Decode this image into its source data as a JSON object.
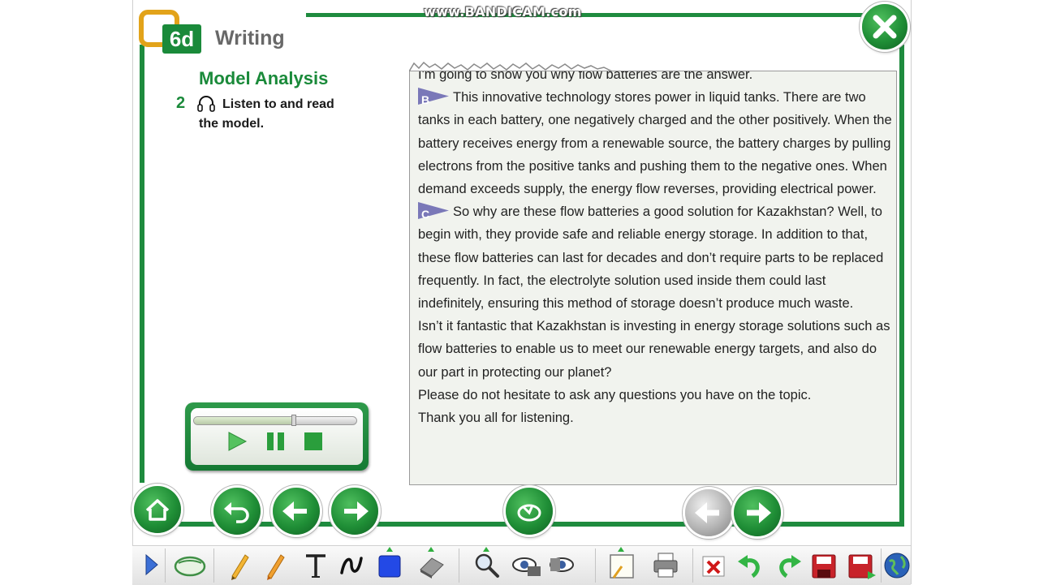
{
  "watermark": "www.BANDICAM.com",
  "header": {
    "lesson_number": "6d",
    "lesson_title": "Writing"
  },
  "section": {
    "title": "Model Analysis",
    "task_number": "2",
    "task_text": "Listen to and read the model."
  },
  "model_text": {
    "cut_line": "I'm going to show you why flow batteries are the answer.",
    "paragraph_b_marker": "B",
    "paragraph_b": "This innovative technology stores power in liquid tanks. There are two tanks in each battery, one negatively charged and the other positively. When the battery receives energy from a renewable source, the battery charges by pulling electrons from the positive tanks and pushing them to the negative ones. When demand exceeds supply, the energy flow reverses, providing electrical power.",
    "paragraph_c_marker": "C",
    "paragraph_c": "So why are these flow batteries a good solution for Kazakhstan? Well, to begin with, they provide safe and reliable energy storage. In addition to that, these flow batteries can last for decades and don’t require parts to be replaced frequently. In fact, the electrolyte solution used inside them could last indefinitely, ensuring this method of storage doesn’t produce much waste.",
    "paragraph_d": "Isn’t it fantastic that Kazakhstan is investing in energy storage solutions such as flow batteries to enable us to meet our renewable energy targets, and also do our part in protecting our planet?",
    "paragraph_e": "Please do not hesitate to ask any questions you have on the topic.",
    "paragraph_f": "Thank you all for listening."
  },
  "player": {
    "progress": 0.61
  },
  "colors": {
    "brand_green": "#1e8b3e",
    "marker_purple": "#7a78b8",
    "panel_bg": "#f1f3ee"
  },
  "nav_icons": [
    "home-icon",
    "undo-icon",
    "arrow-left-icon",
    "arrow-right-icon",
    "refresh-icon",
    "previous-page-icon",
    "next-page-icon",
    "close-icon"
  ],
  "toolbar_icons": [
    "expand-arrow-icon",
    "mouse-icon",
    "pencil-icon",
    "highlighter-icon",
    "text-icon",
    "freehand-icon",
    "shape-icon",
    "eraser-icon",
    "zoom-icon",
    "spotlight-icon",
    "hide-reveal-icon",
    "notepad-icon",
    "print-icon",
    "clear-icon",
    "undo-icon",
    "redo-icon",
    "save-icon",
    "save-as-icon",
    "globe-icon"
  ]
}
